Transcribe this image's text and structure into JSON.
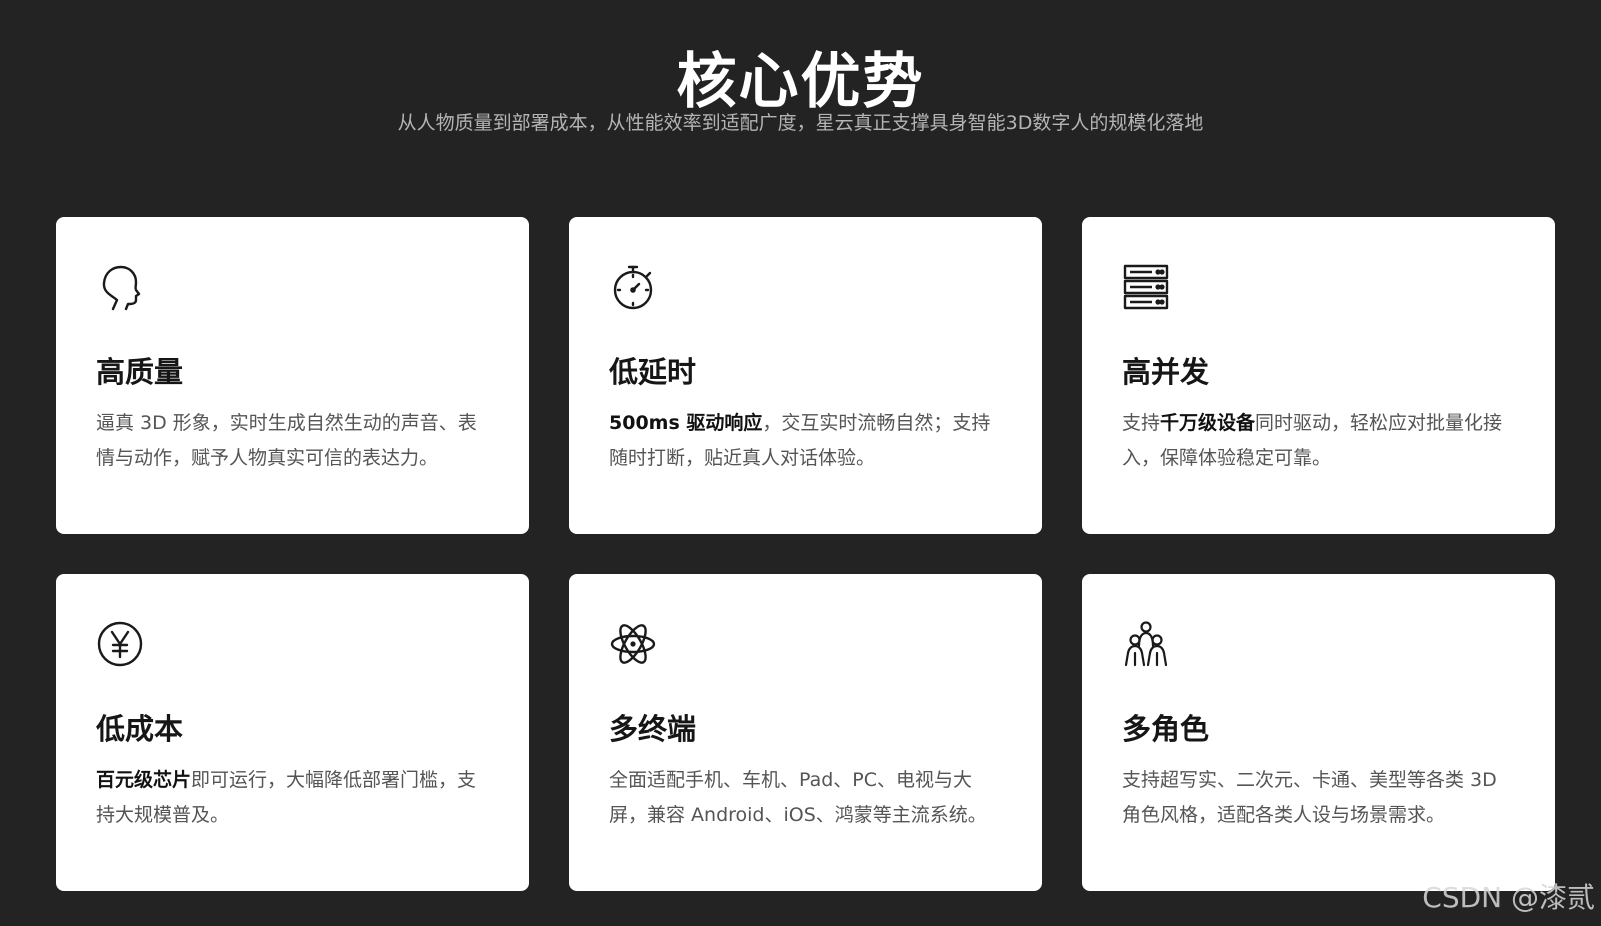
{
  "header": {
    "title": "核心优势",
    "subtitle": "从人物质量到部署成本，从性能效率到适配广度，星云真正支撑具身智能3D数字人的规模化落地"
  },
  "cards": [
    {
      "icon": "head-profile-icon",
      "title": "高质量",
      "desc_before": "逼真 3D 形象，实时生成自然生动的声音、表情与动作，赋予人物真实可信的表达力。",
      "desc_bold": "",
      "desc_after": ""
    },
    {
      "icon": "stopwatch-icon",
      "title": "低延时",
      "desc_before": "",
      "desc_bold": "500ms 驱动响应",
      "desc_after": "，交互实时流畅自然；支持随时打断，贴近真人对话体验。"
    },
    {
      "icon": "server-stack-icon",
      "title": "高并发",
      "desc_before": "支持",
      "desc_bold": "千万级设备",
      "desc_after": "同时驱动，轻松应对批量化接入，保障体验稳定可靠。"
    },
    {
      "icon": "yen-circle-icon",
      "title": "低成本",
      "desc_before": "",
      "desc_bold": "百元级芯片",
      "desc_after": "即可运行，大幅降低部署门槛，支持大规模普及。"
    },
    {
      "icon": "atom-icon",
      "title": "多终端",
      "desc_before": "全面适配手机、车机、Pad、PC、电视与大屏，兼容 Android、iOS、鸿蒙等主流系统。",
      "desc_bold": "",
      "desc_after": ""
    },
    {
      "icon": "people-group-icon",
      "title": "多角色",
      "desc_before": "支持超写实、二次元、卡通、美型等各类 3D 角色风格，适配各类人设与场景需求。",
      "desc_bold": "",
      "desc_after": ""
    }
  ],
  "watermark": "CSDN @漆贰",
  "colors": {
    "background": "#232323",
    "card": "#ffffff",
    "title": "#ffffff",
    "subtitle": "#b4b4b4",
    "card_title": "#161616",
    "card_text": "#555555"
  }
}
